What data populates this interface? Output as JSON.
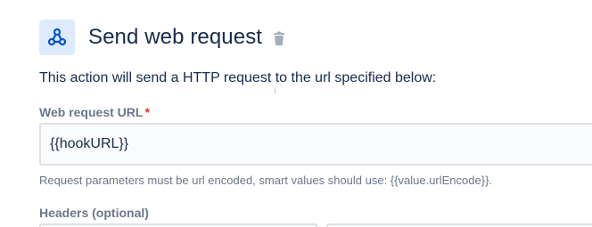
{
  "header": {
    "title": "Send web request",
    "icon": "webhook-icon",
    "delete_icon": "trash-icon"
  },
  "description": "This action will send a HTTP request to the url specified below:",
  "url_field": {
    "label": "Web request URL",
    "required_marker": "*",
    "value": "{{hookURL}}",
    "helper": "Request parameters must be url encoded, smart values should use: {{value.urlEncode}}."
  },
  "headers_field": {
    "label": "Headers (optional)"
  },
  "colors": {
    "accent": "#0052cc",
    "icon_tile": "#deebff",
    "required": "#de350b",
    "muted": "#6b778c",
    "text": "#172b4d"
  }
}
